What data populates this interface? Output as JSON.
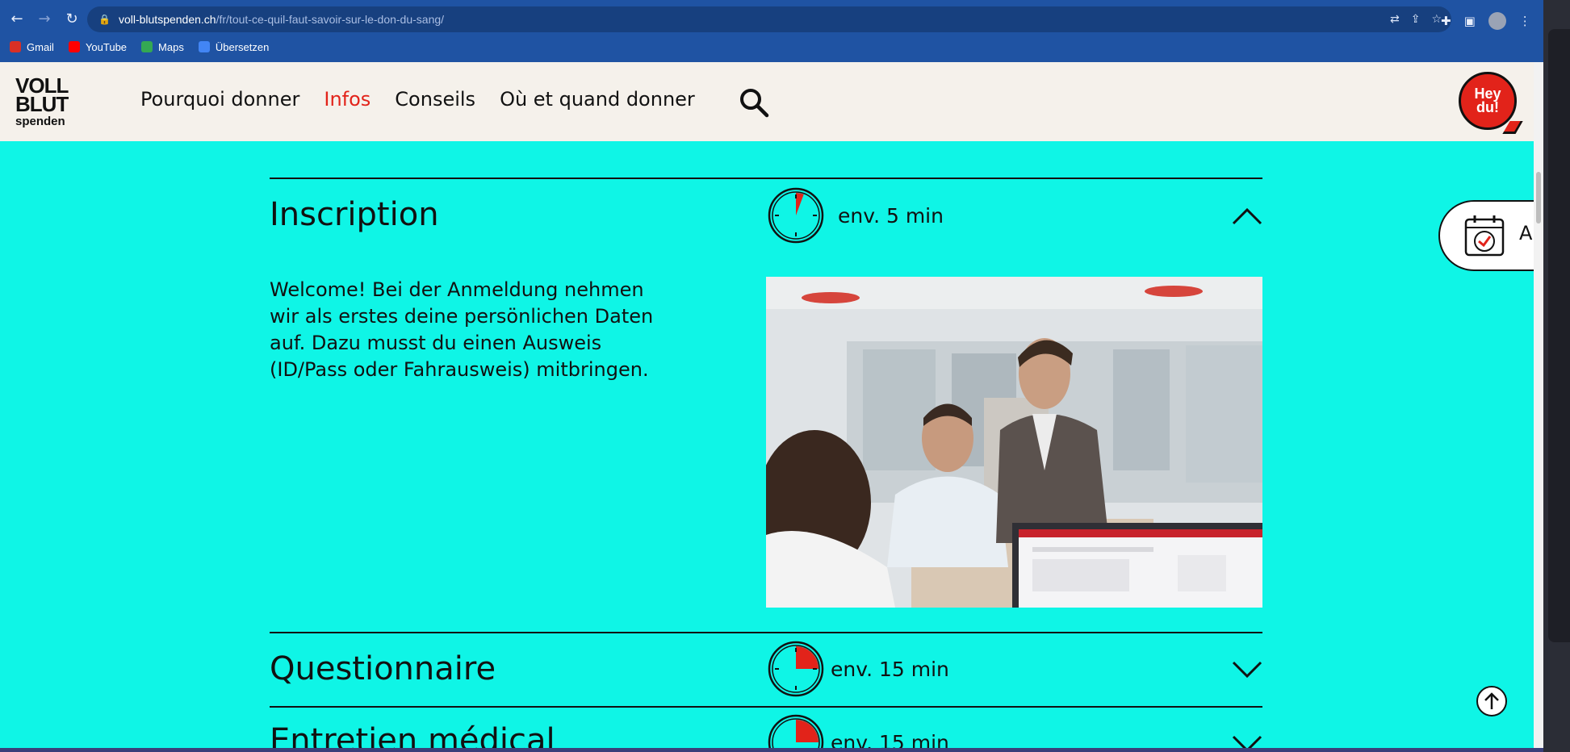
{
  "browser": {
    "url_host": "voll-blutspenden.ch",
    "url_path": "/fr/tout-ce-quil-faut-savoir-sur-le-don-du-sang/",
    "bookmarks": [
      {
        "label": "Gmail",
        "color": "#d93025"
      },
      {
        "label": "YouTube",
        "color": "#ff0000"
      },
      {
        "label": "Maps",
        "color": "#34a853"
      },
      {
        "label": "Übersetzen",
        "color": "#4285f4"
      }
    ]
  },
  "header": {
    "logo_line1": "VOLL",
    "logo_line2": "BLUT",
    "logo_line3": "spenden",
    "nav": [
      "Pourquoi donner",
      "Infos",
      "Conseils",
      "Où et quand donner"
    ],
    "active_nav": "Infos",
    "hey_badge": "Hey du!",
    "hey_line1": "Hey",
    "hey_line2": "du!"
  },
  "colors": {
    "page_bg": "#0ff5e6",
    "accent_red": "#e2231a",
    "header_bg": "#f5f1eb",
    "browser_blue": "#1f53a3"
  },
  "accordion": [
    {
      "title": "Inscription",
      "duration": "env. 5 min",
      "minutes": 5,
      "expanded": true,
      "body": "Welcome! Bei der Anmeldung nehmen wir als erstes deine persönlichen Daten auf. Dazu musst du einen Ausweis (ID/Pass oder Fahrausweis) mitbringen."
    },
    {
      "title": "Questionnaire",
      "duration": "env. 15 min",
      "minutes": 15,
      "expanded": false
    },
    {
      "title": "Entretien médical",
      "duration": "env. 15 min",
      "minutes": 15,
      "expanded": false
    }
  ],
  "appointment_button": {
    "label": "A",
    "icon": "calendar-check-icon"
  },
  "back_to_top": {
    "icon": "arrow-up-icon"
  }
}
